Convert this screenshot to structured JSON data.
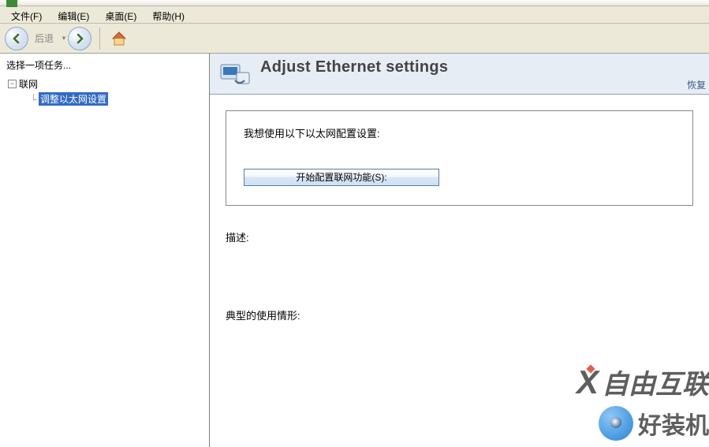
{
  "menubar": {
    "file": "文件(F)",
    "edit": "编辑(E)",
    "desktop": "桌面(E)",
    "help": "帮助(H)"
  },
  "toolbar": {
    "back_label": "后退"
  },
  "sidebar": {
    "header": "选择一项任务...",
    "root_label": "联网",
    "child_label": "调整以太网设置"
  },
  "page": {
    "title": "Adjust Ethernet settings",
    "restore": "恢复",
    "settings_label": "我想使用以下以太网配置设置:",
    "config_button": "开始配置联网功能(S):",
    "desc_label": "描述:",
    "usage_label": "典型的使用情形:"
  },
  "watermarks": {
    "w1": "自由互联",
    "w2": "好装机"
  }
}
